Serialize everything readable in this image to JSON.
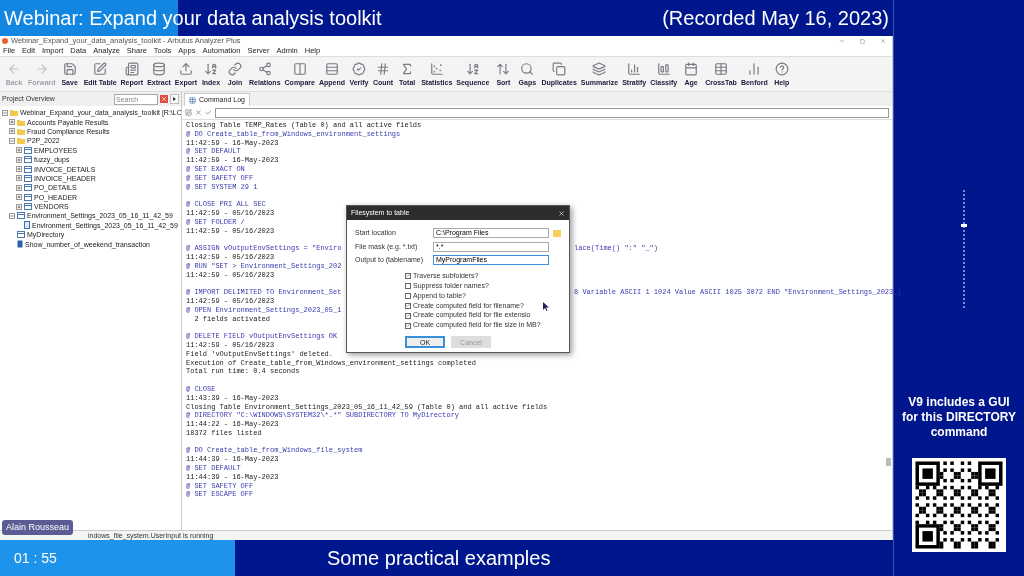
{
  "banner": {
    "title": "Webinar: Expand your data analysis toolkit",
    "recorded": "(Recorded May 16, 2023)"
  },
  "window": {
    "title": "Webinar_Expand_your_data_analysis_toolkit - Arbutus Analyzer Plus"
  },
  "menu": [
    "File",
    "Edit",
    "Import",
    "Data",
    "Analyze",
    "Share",
    "Tools",
    "Apps",
    "Automation",
    "Server",
    "Admin",
    "Help"
  ],
  "toolbar": [
    {
      "label": "Back",
      "disabled": true
    },
    {
      "label": "Forward",
      "disabled": true
    },
    {
      "label": "Save",
      "disabled": false
    },
    {
      "label": "Edit Table",
      "disabled": false
    },
    {
      "label": "Report",
      "disabled": false
    },
    {
      "label": "Extract",
      "disabled": false
    },
    {
      "label": "Export",
      "disabled": false
    },
    {
      "label": "Index",
      "disabled": false
    },
    {
      "label": "Join",
      "disabled": false
    },
    {
      "label": "Relations",
      "disabled": false
    },
    {
      "label": "Compare",
      "disabled": false
    },
    {
      "label": "Append",
      "disabled": false
    },
    {
      "label": "Verify",
      "disabled": false
    },
    {
      "label": "Count",
      "disabled": false
    },
    {
      "label": "Total",
      "disabled": false
    },
    {
      "label": "Statistics",
      "disabled": false
    },
    {
      "label": "Sequence",
      "disabled": false
    },
    {
      "label": "Sort",
      "disabled": false
    },
    {
      "label": "Gaps",
      "disabled": false
    },
    {
      "label": "Duplicates",
      "disabled": false
    },
    {
      "label": "Summarize",
      "disabled": false
    },
    {
      "label": "Stratify",
      "disabled": false
    },
    {
      "label": "Classify",
      "disabled": false
    },
    {
      "label": "Age",
      "disabled": false
    },
    {
      "label": "CrossTab",
      "disabled": false
    },
    {
      "label": "Benford",
      "disabled": false
    },
    {
      "label": "Help",
      "disabled": false
    }
  ],
  "project_overview": {
    "title": "Project Overview",
    "search": {
      "placeholder": "Search"
    },
    "tree": [
      {
        "kind": "project",
        "label": "Webinar_Expand_your_data_analysis_toolkit [R:\\LO",
        "expanded": true,
        "children": [
          {
            "kind": "folder",
            "label": "Accounts Payable Results",
            "expanded": false
          },
          {
            "kind": "folder",
            "label": "Fraud Compliance Results",
            "expanded": false
          },
          {
            "kind": "folder",
            "label": "P2P_2022",
            "expanded": true,
            "children": [
              {
                "kind": "table",
                "label": "EMPLOYEES",
                "expanded": false
              },
              {
                "kind": "table",
                "label": "fuzzy_dups",
                "expanded": false
              },
              {
                "kind": "table",
                "label": "INVOICE_DETAILS",
                "expanded": false
              },
              {
                "kind": "table",
                "label": "INVOICE_HEADER",
                "expanded": false
              },
              {
                "kind": "table",
                "label": "PO_DETAILS",
                "expanded": false
              },
              {
                "kind": "table",
                "label": "PO_HEADER",
                "expanded": false
              },
              {
                "kind": "table",
                "label": "VENDORS",
                "expanded": false
              }
            ]
          },
          {
            "kind": "table",
            "label": "Environment_Settings_2023_05_16_11_42_59",
            "expanded": true,
            "children": [
              {
                "kind": "view",
                "label": "Environment_Settings_2023_05_16_11_42_59"
              }
            ]
          },
          {
            "kind": "table",
            "label": "MyDirectory"
          },
          {
            "kind": "script",
            "label": "Show_number_of_weekend_transaction"
          }
        ]
      }
    ]
  },
  "command_log": {
    "tab": "Command Log",
    "lines": [
      {
        "kind": "output",
        "text": "Closing Table TEMP_Rates (Table 0) and all active fields"
      },
      {
        "kind": "command",
        "text": "@ DO Create_table_from_Windows_environment_settings"
      },
      {
        "kind": "output",
        "text": "11:42:59 - 16-May-2023"
      },
      {
        "kind": "command",
        "text": "@ SET DEFAULT"
      },
      {
        "kind": "output",
        "text": "11:42:59 - 16-May-2023"
      },
      {
        "kind": "command",
        "text": "@ SET EXACT ON"
      },
      {
        "kind": "command",
        "text": "@ SET SAFETY OFF"
      },
      {
        "kind": "command",
        "text": "@ SET SYSTEM 29 1"
      },
      {
        "kind": "blank"
      },
      {
        "kind": "command",
        "text": "@ CLOSE PRI ALL SEC"
      },
      {
        "kind": "output",
        "text": "11:42:59 - 05/16/2023"
      },
      {
        "kind": "command",
        "text": "@ SET FOLDER /"
      },
      {
        "kind": "output",
        "text": "11:42:59 - 05/16/2023"
      },
      {
        "kind": "blank"
      },
      {
        "kind": "command",
        "text": "@ ASSIGN vOutputEnvSettings = \"Enviro",
        "tail": "lace(Time() \":\" \"_\")"
      },
      {
        "kind": "output",
        "text": "11:42:59 - 05/16/2023"
      },
      {
        "kind": "command",
        "text": "@ RUN \"SET > Environment_Settings_202"
      },
      {
        "kind": "output",
        "text": "11:42:59 - 05/16/2023"
      },
      {
        "kind": "blank"
      },
      {
        "kind": "command",
        "text": "@ IMPORT DELIMITED TO Environment_Set",
        "tail": "8 Variable ASCII 1 1024 Value ASCII 1025 3072 END \"Environment_Settings_2023_("
      },
      {
        "kind": "output",
        "text": "11:42:59 - 05/16/2023"
      },
      {
        "kind": "command",
        "text": "@ OPEN Environment_Settings_2023_05_1"
      },
      {
        "kind": "output",
        "text": "  2 fields activated"
      },
      {
        "kind": "blank"
      },
      {
        "kind": "command",
        "text": "@ DELETE FIELD vOutputEnvSettings OK"
      },
      {
        "kind": "output",
        "text": "11:42:59 - 05/16/2023"
      },
      {
        "kind": "output",
        "text": "Field 'vOutputEnvSettings' deleted."
      },
      {
        "kind": "output",
        "text": "Execution of Create_table_from_Windows_environment_settings completed"
      },
      {
        "kind": "output",
        "text": "Total run time: 0.4 seconds"
      },
      {
        "kind": "blank"
      },
      {
        "kind": "command",
        "text": "@ CLOSE"
      },
      {
        "kind": "output",
        "text": "11:43:39 - 16-May-2023"
      },
      {
        "kind": "output",
        "text": "Closing Table Environment_Settings_2023_05_16_11_42_59 (Table 0) and all active fields"
      },
      {
        "kind": "command",
        "text": "@ DIRECTORY \"C:\\WINDOWS\\SYSTEM32\\*.*\" SUBDIRECTORY TO MyDirectory"
      },
      {
        "kind": "output",
        "text": "11:44:22 - 16-May-2023"
      },
      {
        "kind": "output",
        "text": "18372 files listed"
      },
      {
        "kind": "blank"
      },
      {
        "kind": "command",
        "text": "@ DO Create_table_from_Windows_file_system"
      },
      {
        "kind": "output",
        "text": "11:44:39 - 16-May-2023"
      },
      {
        "kind": "command",
        "text": "@ SET DEFAULT"
      },
      {
        "kind": "output",
        "text": "11:44:39 - 16-May-2023"
      },
      {
        "kind": "command",
        "text": "@ SET SAFETY OFF"
      },
      {
        "kind": "command",
        "text": "@ SET ESCAPE OFF"
      }
    ]
  },
  "dialog": {
    "title": "Filesystem to table",
    "fields": [
      {
        "label": "Start location",
        "value": "C:\\Program Files",
        "browse": true,
        "focused": false
      },
      {
        "label": "File mask (e.g. *.txt)",
        "value": "*.*",
        "browse": false,
        "focused": false
      },
      {
        "label": "Output to (tablename)",
        "value": "MyProgramFiles",
        "browse": false,
        "focused": true
      }
    ],
    "options": [
      {
        "label": "Traverse subfolders?",
        "checked": true
      },
      {
        "label": "Suppress folder names?",
        "checked": false
      },
      {
        "label": "Append to table?",
        "checked": false
      },
      {
        "label": "Create computed field for filename?",
        "checked": true
      },
      {
        "label": "Create computed field for file extensio",
        "checked": true
      },
      {
        "label": "Create computed field for file size in MB?",
        "checked": true
      }
    ],
    "buttons": [
      {
        "label": "OK",
        "disabled": false
      },
      {
        "label": "Cancel",
        "disabled": true
      }
    ]
  },
  "status_bar": "indows_file_system.UserInput is running",
  "presenter": "Alain Rousseau",
  "side_note": "V9 includes a GUI for this DIRECTORY command",
  "footer": {
    "time": "01 : 55",
    "caption": "Some practical examples"
  }
}
